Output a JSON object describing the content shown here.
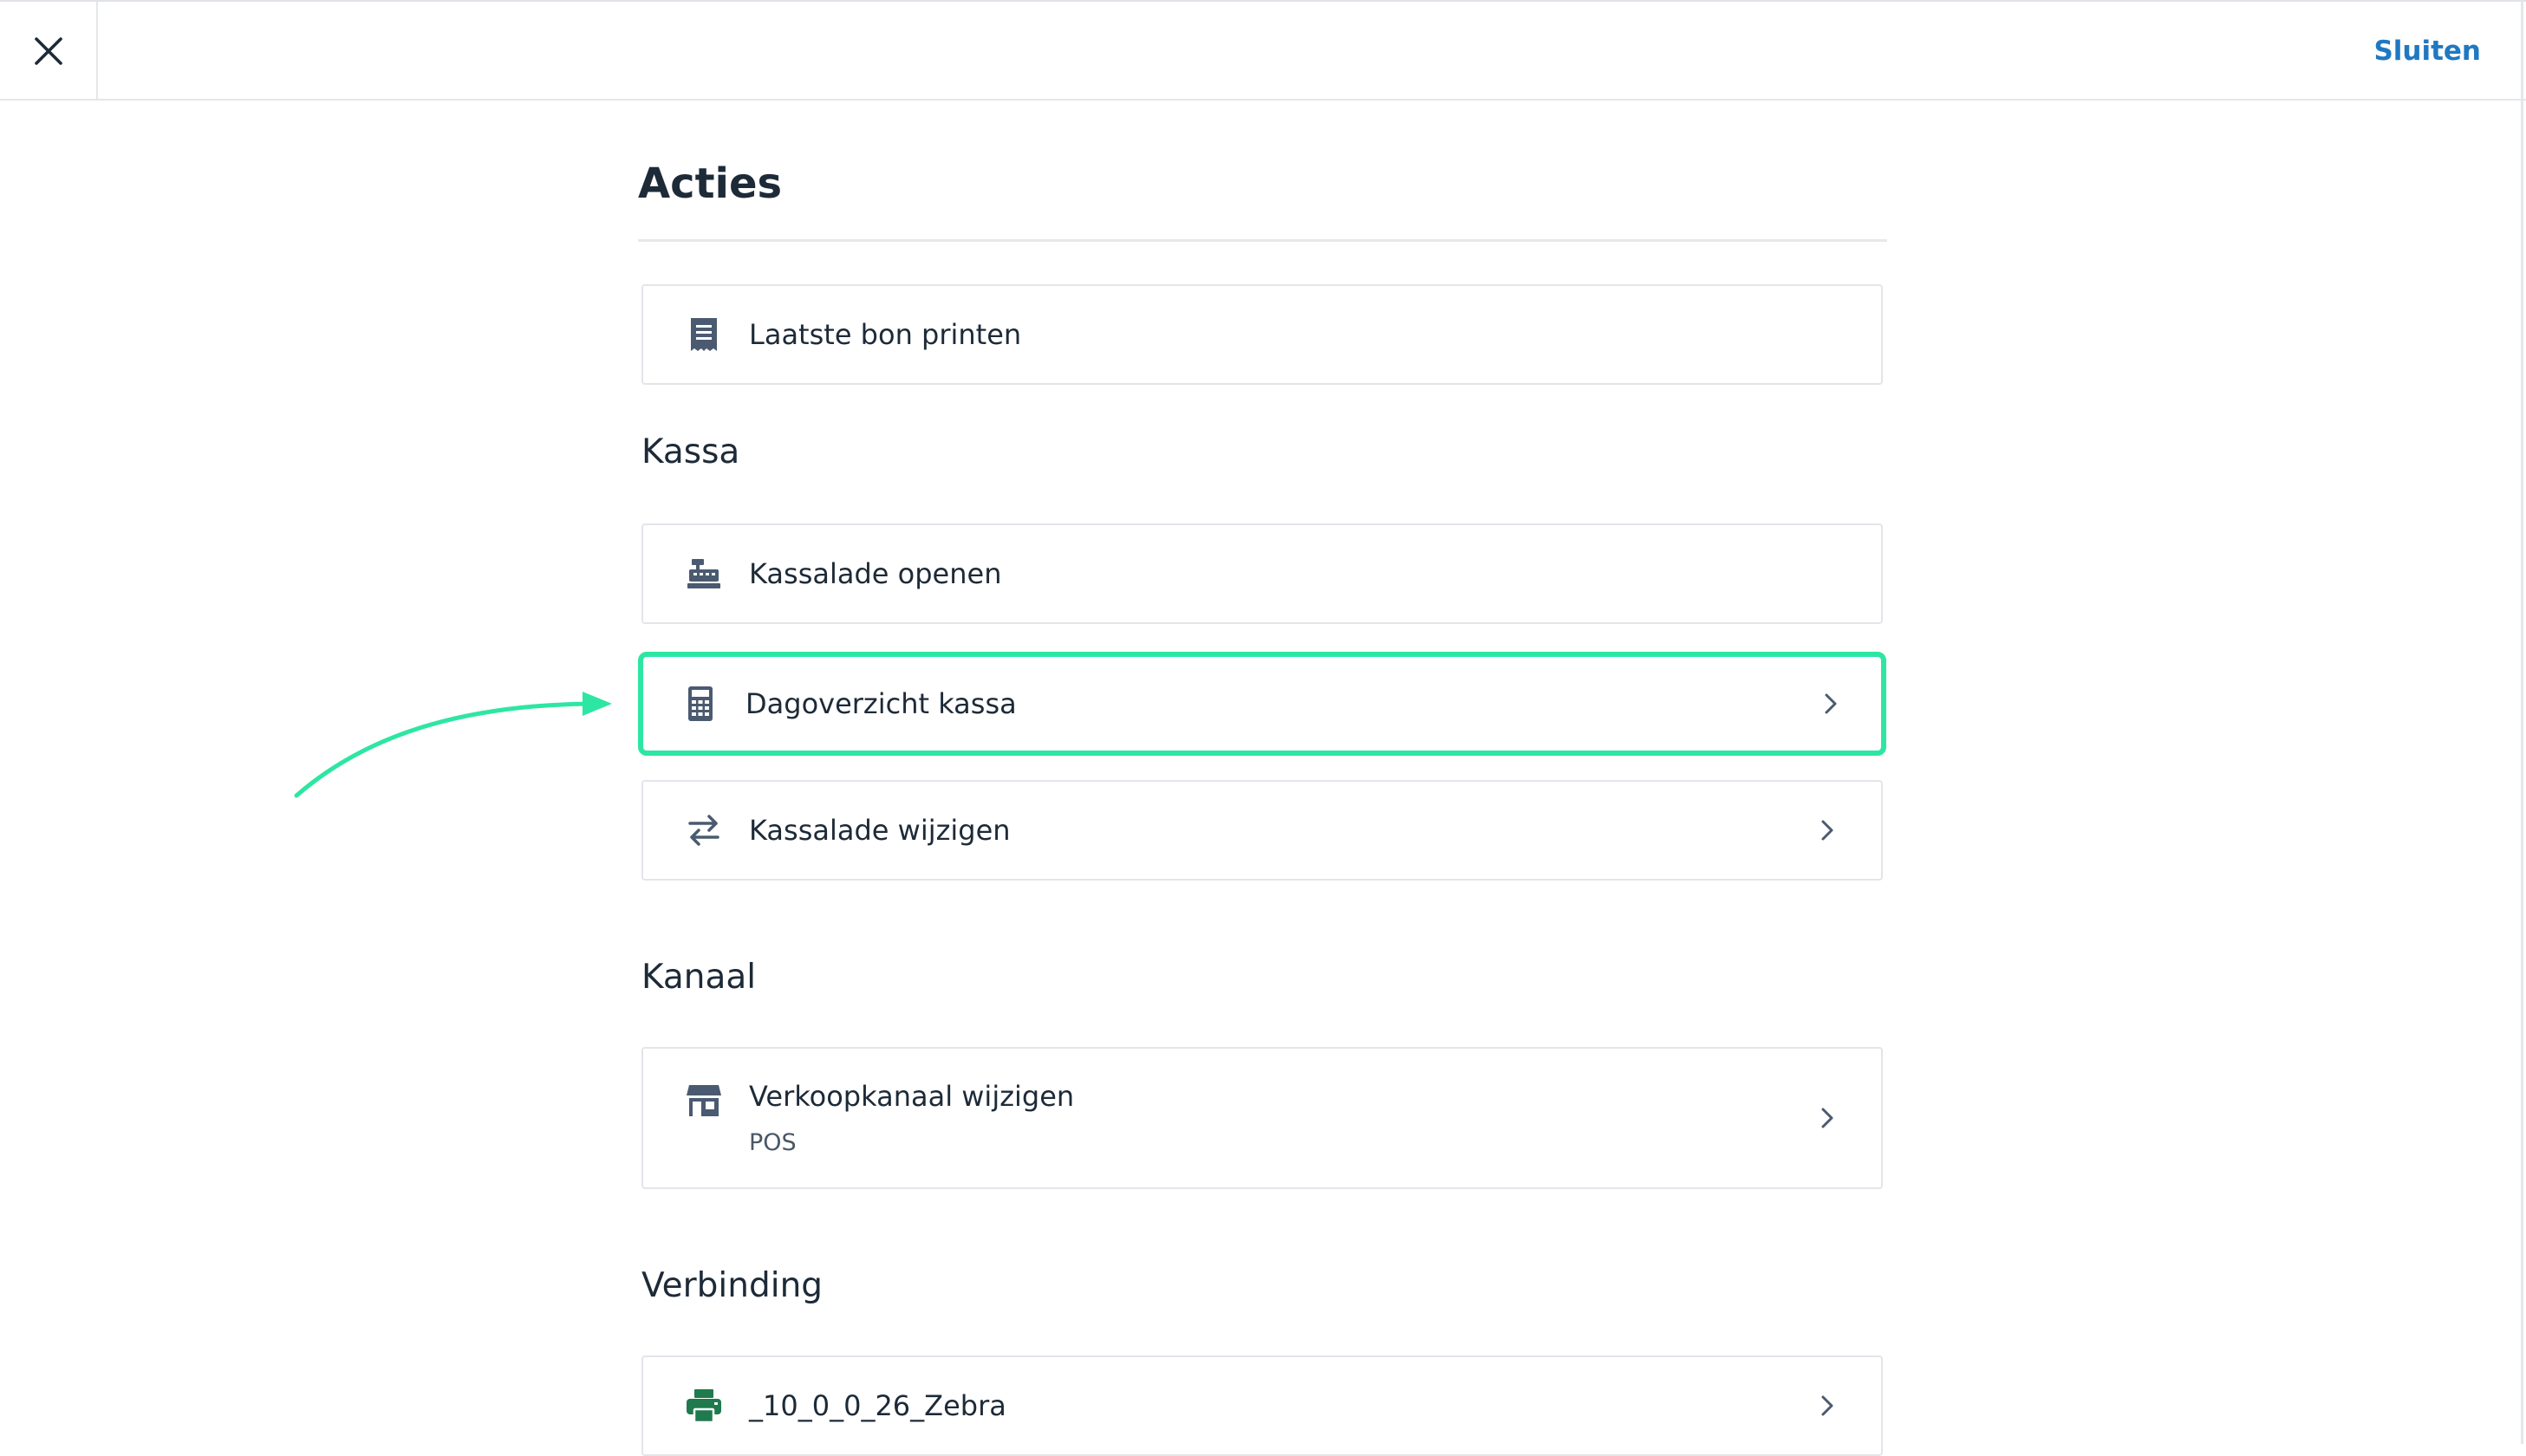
{
  "header": {
    "close_label": "close",
    "close_action": "Sluiten"
  },
  "main": {
    "title": "Acties",
    "top_actions": [
      {
        "label": "Laatste bon printen",
        "icon": "receipt-icon"
      }
    ],
    "sections": [
      {
        "title": "Kassa",
        "items": [
          {
            "label": "Kassalade openen",
            "icon": "cash-register-icon",
            "has_chevron": false
          },
          {
            "label": "Dagoverzicht kassa",
            "icon": "calculator-icon",
            "has_chevron": true,
            "highlighted": true
          },
          {
            "label": "Kassalade wijzigen",
            "icon": "swap-arrows-icon",
            "has_chevron": true
          }
        ]
      },
      {
        "title": "Kanaal",
        "items": [
          {
            "label": "Verkoopkanaal wijzigen",
            "sublabel": "POS",
            "icon": "store-icon",
            "has_chevron": true
          }
        ]
      },
      {
        "title": "Verbinding",
        "items": [
          {
            "label": "_10_0_0_26_Zebra",
            "icon": "printer-icon",
            "icon_color": "#1f7a4d",
            "has_chevron": true
          }
        ]
      }
    ]
  },
  "colors": {
    "accent_link": "#1f78c2",
    "highlight": "#2ee6a3",
    "icon_default": "#4a5a70",
    "icon_connected": "#1f7a4d",
    "text": "#1d2a38"
  }
}
